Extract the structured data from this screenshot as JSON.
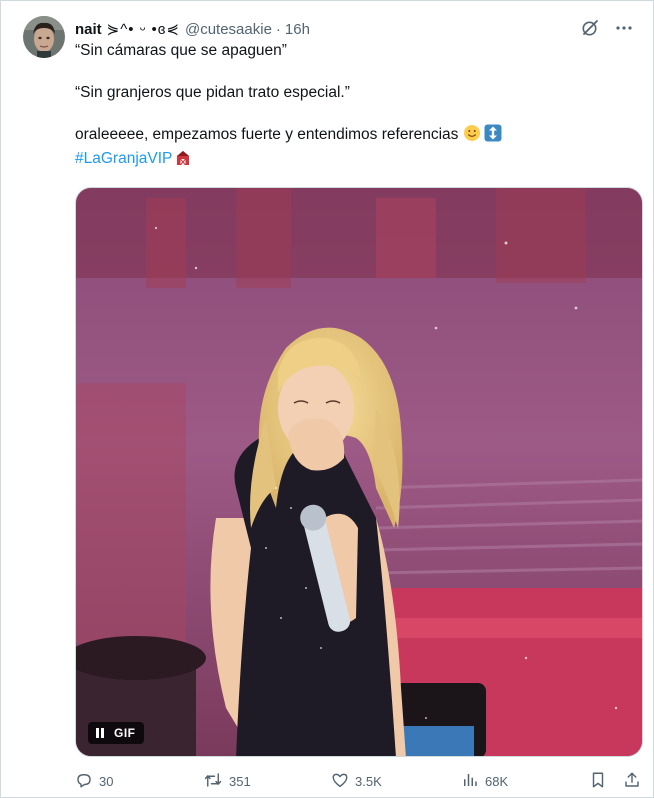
{
  "author": {
    "name": "nait",
    "name_decoration": "⋟^• ᵕ •ɞ⋞",
    "handle": "@cutesaakie",
    "separator": "·",
    "time": "16h"
  },
  "tweet": {
    "line1": "“Sin cámaras que se apaguen”",
    "line2": "“Sin granjeros que pidan trato especial.”",
    "line3": "oraleeeee, empezamos fuerte y entendimos referencias ",
    "hashtag": "#LaGranjaVIP"
  },
  "media": {
    "gif_label": "GIF"
  },
  "actions": {
    "replies": "30",
    "reposts": "351",
    "likes": "3.5K",
    "views": "68K"
  },
  "colors": {
    "accent": "#1d9bf0",
    "secondary_text": "#536471",
    "primary_text": "#0f1419"
  },
  "icons": [
    "grok-icon",
    "more-icon",
    "pause-icon",
    "reply-icon",
    "repost-icon",
    "like-icon",
    "views-icon",
    "bookmark-icon",
    "share-icon",
    "slightly-smiling-emoji",
    "up-down-arrow-emoji",
    "barn-hashtag-icon"
  ]
}
